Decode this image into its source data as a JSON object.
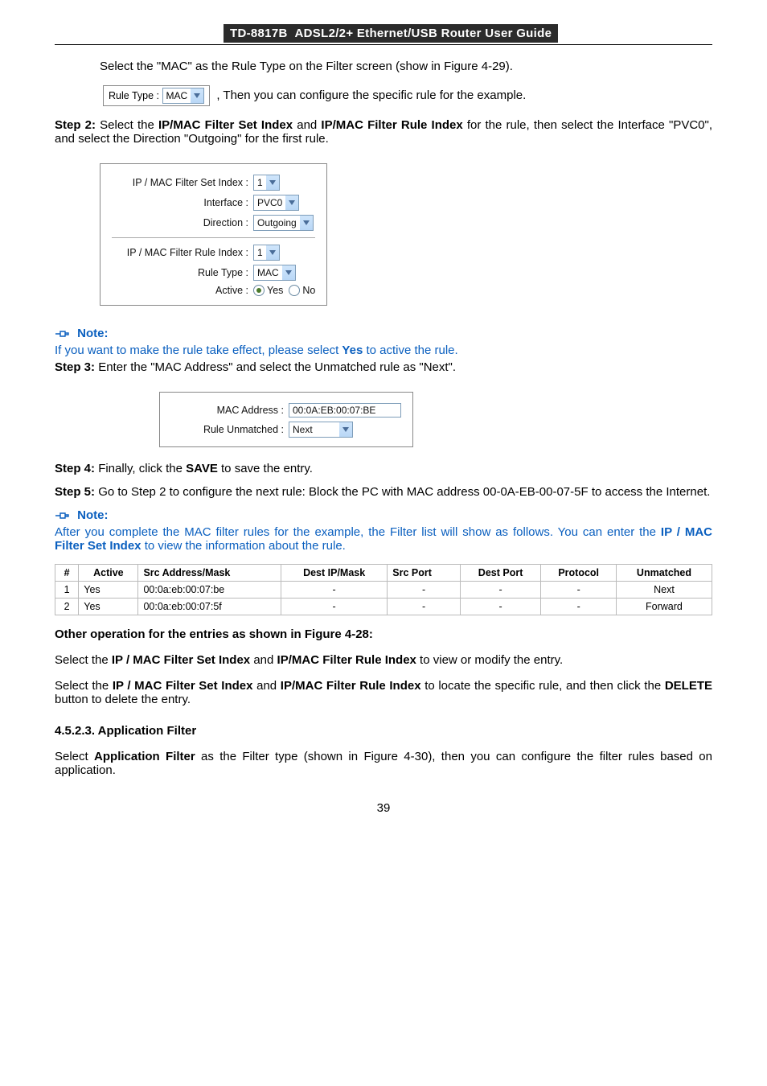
{
  "header": {
    "model": "TD-8817B",
    "title": "ADSL2/2+  Ethernet/USB  Router  User  Guide"
  },
  "intro": {
    "line1": "Select  the  \"MAC\"  as  the  Rule  Type  on  the  Filter  screen  (show  in  Figure  4-29).",
    "inline_label": "Rule Type :",
    "inline_value": "MAC",
    "line2": ", Then you can configure the specific rule for the example."
  },
  "step2": {
    "label": "Step 2:",
    "t1": "Select the ",
    "b1": "IP/MAC Filter Set Index",
    "t2": " and ",
    "b2": "IP/MAC Filter Rule Index",
    "t3": " for the rule, then select the Interface \"PVC0\", and select the Direction \"Outgoing\" for the first rule."
  },
  "form1": {
    "f1": {
      "label": "IP / MAC Filter Set Index :",
      "value": "1"
    },
    "f2": {
      "label": "Interface :",
      "value": "PVC0"
    },
    "f3": {
      "label": "Direction :",
      "value": "Outgoing"
    },
    "f4": {
      "label": "IP / MAC Filter Rule Index :",
      "value": "1"
    },
    "f5": {
      "label": "Rule Type :",
      "value": "MAC"
    },
    "f6": {
      "label": "Active :",
      "yes": "Yes",
      "no": "No"
    }
  },
  "note1": {
    "label": "Note:",
    "text": "If you want to make the rule take effect, please select ",
    "yes": "Yes",
    "text2": " to active the rule."
  },
  "step3": {
    "label": "Step 3:",
    "text": "Enter the \"MAC Address\" and select the Unmatched rule as \"Next\"."
  },
  "form2": {
    "f1": {
      "label": "MAC Address :",
      "value": "00:0A:EB:00:07:BE"
    },
    "f2": {
      "label": "Rule Unmatched :",
      "value": "Next"
    }
  },
  "step4": {
    "label": "Step 4:",
    "t1": "Finally, click the ",
    "b1": "SAVE",
    "t2": " to save the entry."
  },
  "step5": {
    "label": "Step 5:",
    "text": "Go  to  Step  2  to  configure  the  next  rule:  Block  the  PC  with  MAC  address 00-0A-EB-00-07-5F to access the Internet."
  },
  "note2": {
    "label": "Note:",
    "p1": "After you complete the MAC filter rules for the example, the Filter list will show as follows. You can enter the ",
    "b": "IP / MAC Filter Set Index",
    "p2": " to view the information about the rule."
  },
  "table": {
    "headers": {
      "c0": "#",
      "c1": "Active",
      "c2": "Src Address/Mask",
      "c3": "Dest IP/Mask",
      "c4": "Src Port",
      "c5": "Dest Port",
      "c6": "Protocol",
      "c7": "Unmatched"
    },
    "rows": [
      {
        "c0": "1",
        "c1": "Yes",
        "c2": "00:0a:eb:00:07:be",
        "c3": "-",
        "c4": "-",
        "c5": "-",
        "c6": "-",
        "c7": "Next"
      },
      {
        "c0": "2",
        "c1": "Yes",
        "c2": "00:0a:eb:00:07:5f",
        "c3": "-",
        "c4": "-",
        "c5": "-",
        "c6": "-",
        "c7": "Forward"
      }
    ]
  },
  "other": {
    "heading": "Other operation for the entries as shown in Figure 4-28:",
    "line1": {
      "t1": "Select the ",
      "b1": "IP / MAC Filter Set Index",
      "t2": " and ",
      "b2": "IP/MAC Filter Rule Index",
      "t3": " to view or modify the entry."
    },
    "line2": {
      "t1": "Select the ",
      "b1": "IP / MAC Filter Set Index",
      "t2": " and ",
      "b2": "IP/MAC Filter Rule Index",
      "t3": " to locate the specific rule, and then click the ",
      "b3": "DELETE",
      "t4": " button to delete the entry."
    }
  },
  "app": {
    "heading": "4.5.2.3.  Application Filter",
    "t1": "Select ",
    "b1": "Application Filter",
    "t2": " as the Filter type (shown in Figure 4-30), then you can configure the filter rules based on application."
  },
  "pagenum": "39"
}
